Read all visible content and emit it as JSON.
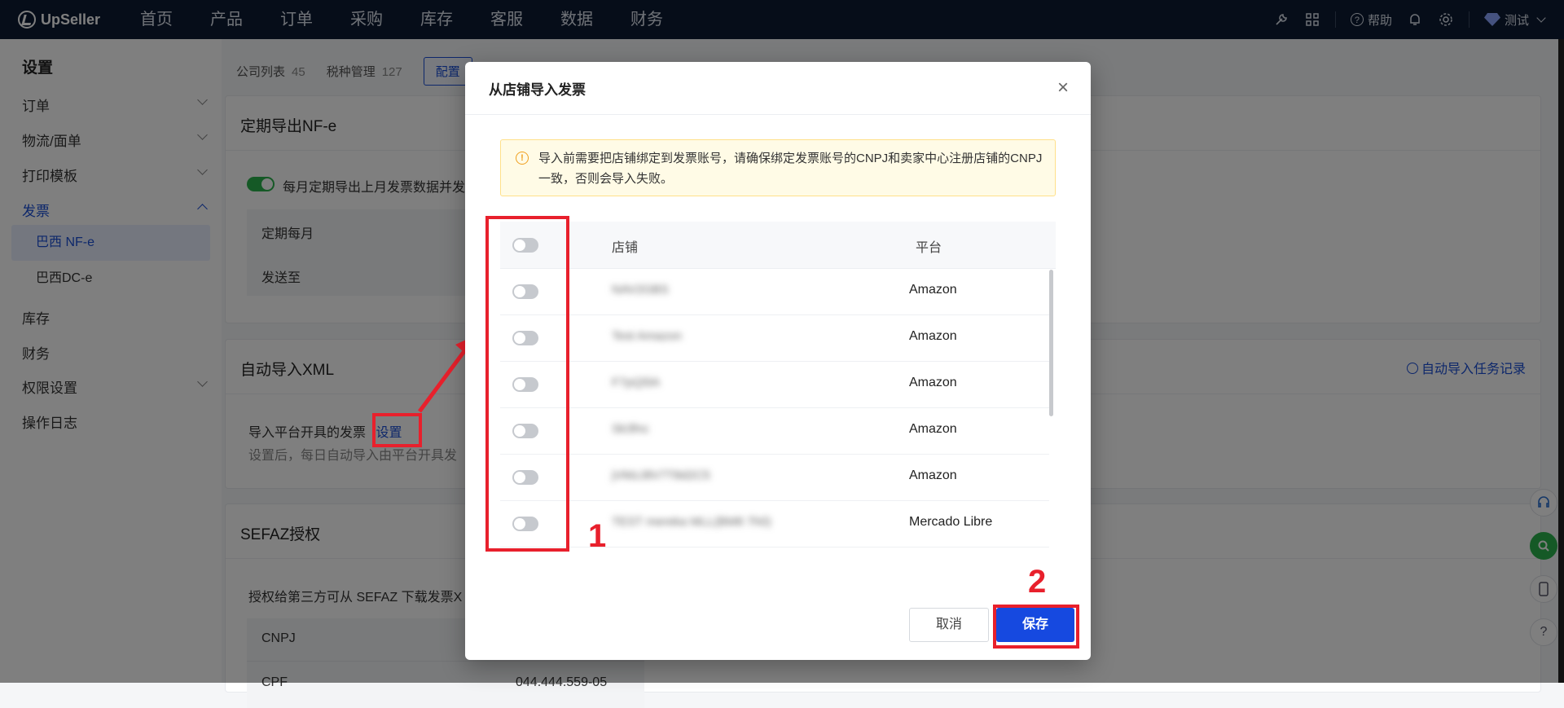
{
  "app": {
    "logo": "UpSeller",
    "nav": [
      "首页",
      "产品",
      "订单",
      "采购",
      "库存",
      "客服",
      "数据",
      "财务"
    ],
    "help_label": "帮助",
    "user_label": "测试"
  },
  "sidebar": {
    "title": "设置",
    "items": [
      {
        "label": "订单"
      },
      {
        "label": "物流/面单"
      },
      {
        "label": "打印模板"
      },
      {
        "label": "发票"
      },
      {
        "label": "库存"
      },
      {
        "label": "财务"
      },
      {
        "label": "权限设置"
      },
      {
        "label": "操作日志"
      }
    ],
    "sub_items": [
      {
        "label": "巴西 NF-e"
      },
      {
        "label": "巴西DC-e"
      }
    ]
  },
  "content": {
    "tabs": [
      {
        "label": "公司列表",
        "count": "45"
      },
      {
        "label": "税种管理",
        "count": "127"
      }
    ],
    "config_button": "配置",
    "card1": {
      "title": "定期导出NF-e",
      "toggle_text": "每月定期导出上月发票数据并发",
      "row1": "定期每月",
      "row2": "发送至"
    },
    "card2": {
      "title": "自动导入XML",
      "record_link": "自动导入任务记录",
      "line1": "导入平台开具的发票",
      "settings_link": "设置",
      "line2": "设置后，每日自动导入由平台开具发"
    },
    "card3": {
      "title": "SEFAZ授权",
      "line1": "授权给第三方可从 SEFAZ 下载发票X",
      "row1": "CNPJ",
      "row2": "CPF",
      "row2_value": "044.444.559-05"
    }
  },
  "modal": {
    "title": "从店铺导入发票",
    "alert": "导入前需要把店铺绑定到发票账号，请确保绑定发票账号的CNPJ和卖家中心注册店铺的CNPJ一致，否则会导入失败。",
    "columns": {
      "shop": "店铺",
      "platform": "平台"
    },
    "rows": [
      {
        "shop": "NAV2GBS",
        "platform": "Amazon"
      },
      {
        "shop": "Test Amazon",
        "platform": "Amazon"
      },
      {
        "shop": "F7pQ5lA",
        "platform": "Amazon"
      },
      {
        "shop": "Sk3fnc",
        "platform": "Amazon"
      },
      {
        "shop": "jVMzJ8V7T8d2C5",
        "platform": "Amazon"
      },
      {
        "shop": "TEST mereka MLL(BM8 7h0)",
        "platform": "Mercado Libre"
      }
    ],
    "cancel": "取消",
    "save": "保存"
  },
  "annotations": {
    "label1": "1",
    "label2": "2",
    "color": "#e8202c"
  }
}
